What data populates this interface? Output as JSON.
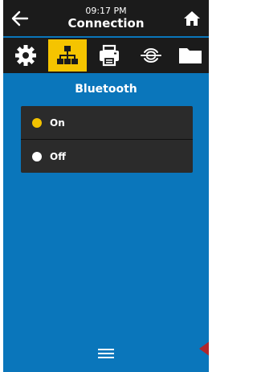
{
  "header": {
    "time": "09:17 PM",
    "title": "Connection",
    "back_icon": "back-arrow-icon",
    "home_icon": "home-icon"
  },
  "tabs": [
    {
      "icon": "settings-gear-icon",
      "active": false
    },
    {
      "icon": "network-connection-icon",
      "active": true
    },
    {
      "icon": "printer-icon",
      "active": false
    },
    {
      "icon": "rfid-wireless-icon",
      "active": false
    },
    {
      "icon": "folder-icon",
      "active": false
    }
  ],
  "section": {
    "title": "Bluetooth"
  },
  "options": [
    {
      "label": "On",
      "selected": true
    },
    {
      "label": "Off",
      "selected": false
    }
  ],
  "footer": {
    "menu_icon": "menu-icon"
  },
  "colors": {
    "background": "#0a76bb",
    "header": "#1b1b1b",
    "accent": "#f5c400",
    "option_bg": "#2b2b2b"
  }
}
